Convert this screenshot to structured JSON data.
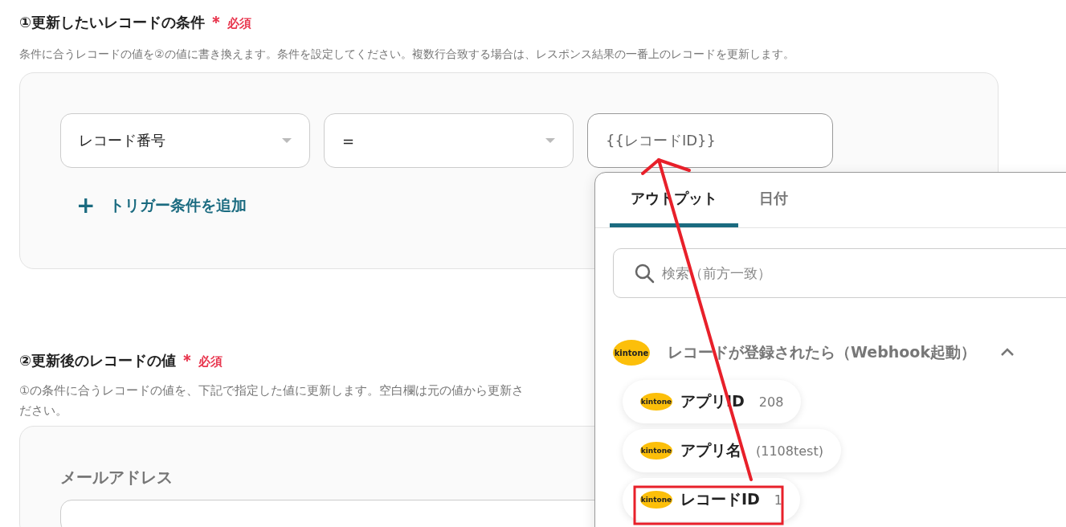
{
  "section_1": {
    "title": "①更新したいレコードの条件",
    "required_mark": "＊",
    "required_label": "必須",
    "description": "条件に合うレコードの値を②の値に書き換えます。条件を設定してください。複数行合致する場合は、レスポンス結果の一番上のレコードを更新します。",
    "condition": {
      "field": "レコード番号",
      "operator": "=",
      "value": "{{レコードID}}"
    },
    "add_button": {
      "icon": "+",
      "label": "トリガー条件を追加"
    }
  },
  "section_2": {
    "title": "②更新後のレコードの値",
    "required_mark": "＊",
    "required_label": "必須",
    "description_lines": [
      "①の条件に合うレコードの値を、下記で指定した値に更新します。空白欄は元の値から更新さ",
      "ださい。"
    ],
    "fields": [
      {
        "label": "メールアドレス"
      }
    ]
  },
  "popup": {
    "tabs": [
      {
        "label": "アウトプット",
        "selected": true
      },
      {
        "label": "日付",
        "selected": false
      }
    ],
    "search": {
      "placeholder": "検索（前方一致）"
    },
    "group": {
      "logo_text": "kintone",
      "title": "レコードが登録されたら（Webhook起動）",
      "expanded": true,
      "items": [
        {
          "logo_text": "kintone",
          "label": "アプリID",
          "value": "208",
          "highlighted": false
        },
        {
          "logo_text": "kintone",
          "label": "アプリ名",
          "value": "(1108test)",
          "highlighted": false
        },
        {
          "logo_text": "kintone",
          "label": "レコードID",
          "value": "1",
          "highlighted": true
        }
      ]
    }
  }
}
